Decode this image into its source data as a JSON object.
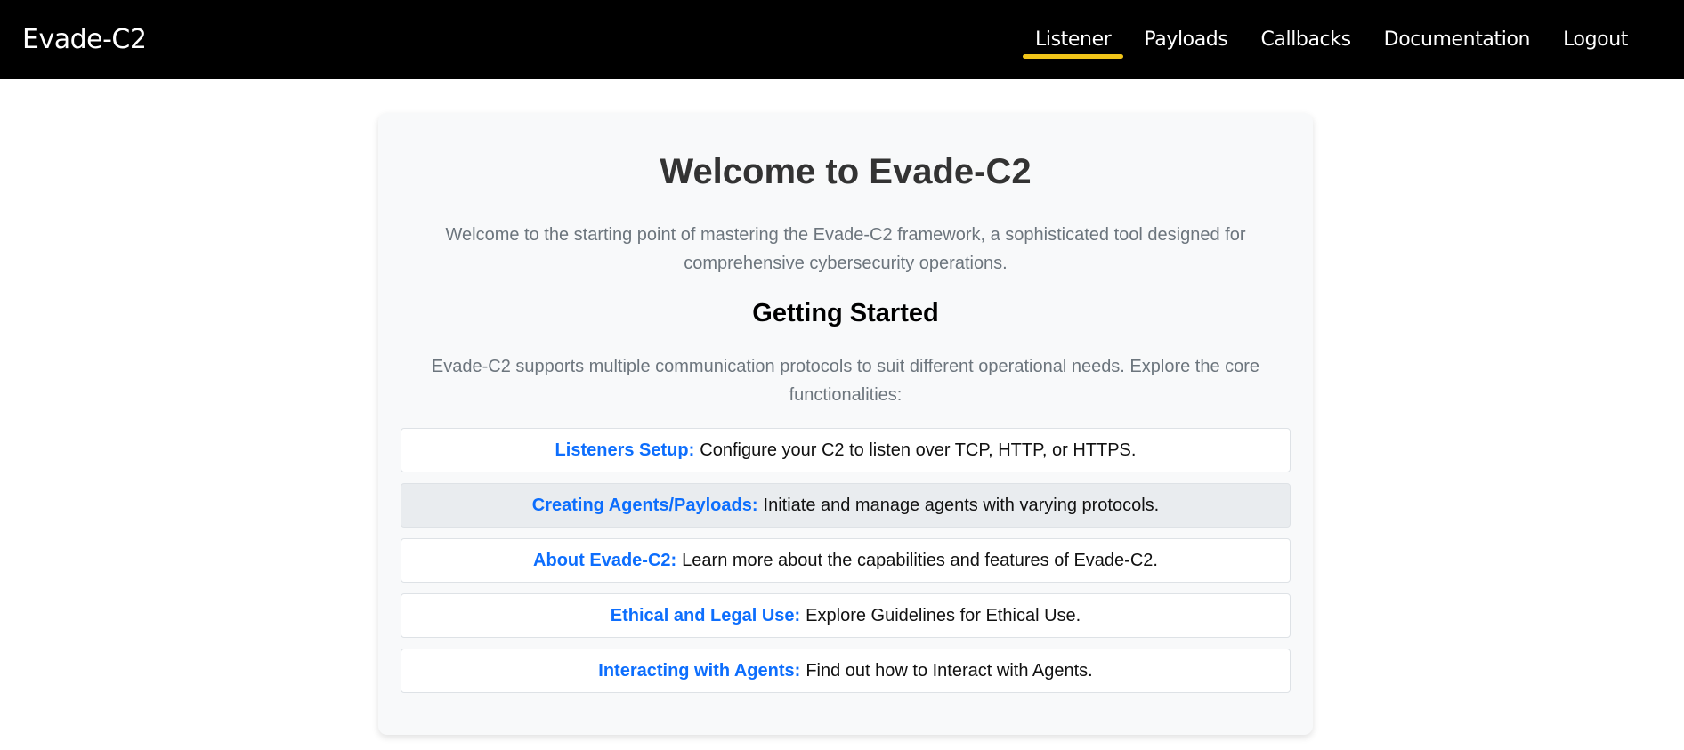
{
  "navbar": {
    "brand": "Evade-C2",
    "links": [
      "Listener",
      "Payloads",
      "Callbacks",
      "Documentation",
      "Logout"
    ],
    "active": "Listener",
    "accent_color": "#f0c419"
  },
  "main": {
    "title": "Welcome to Evade-C2",
    "intro": "Welcome to the starting point of mastering the Evade-C2 framework, a sophisticated tool designed for comprehensive cybersecurity operations.",
    "subtitle": "Getting Started",
    "subintro": "Evade-C2 supports multiple communication protocols to suit different operational needs. Explore the core functionalities:",
    "items": [
      {
        "label": "Listeners Setup:",
        "text": "Configure your C2 to listen over TCP, HTTP, or HTTPS."
      },
      {
        "label": "Creating Agents/Payloads:",
        "text": "Initiate and manage agents with varying protocols."
      },
      {
        "label": "About Evade-C2:",
        "text": "Learn more about the capabilities and features of Evade-C2."
      },
      {
        "label": "Ethical and Legal Use:",
        "text": "Explore Guidelines for Ethical Use."
      },
      {
        "label": "Interacting with Agents:",
        "text": "Find out how to Interact with Agents."
      }
    ],
    "link_color": "#0d6efd"
  }
}
